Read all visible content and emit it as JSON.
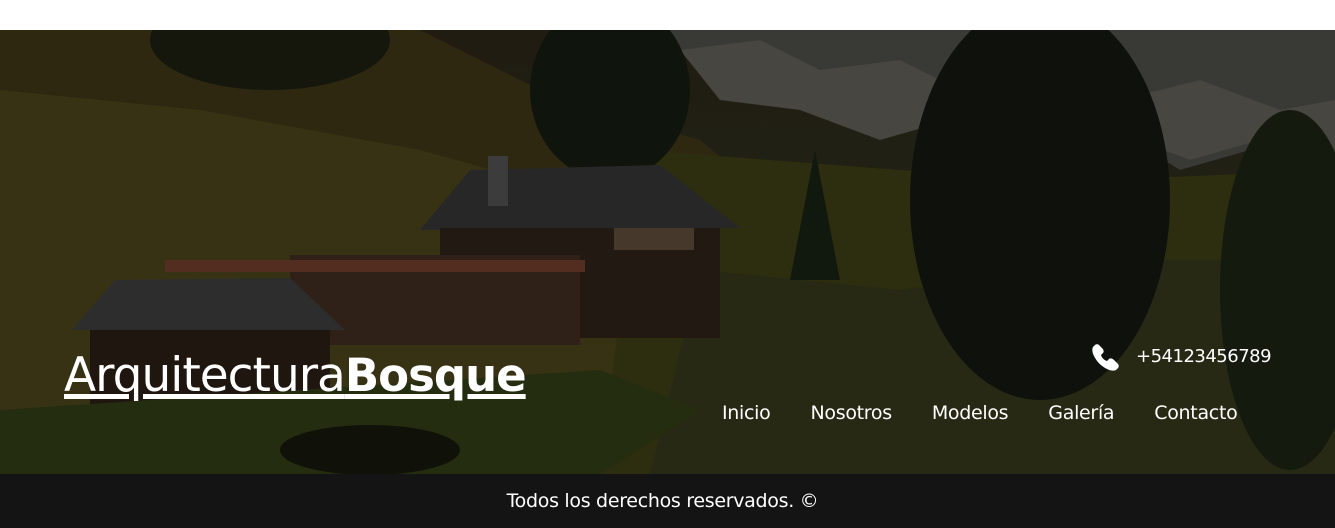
{
  "brand": {
    "light": "Arquitectura",
    "bold": "Bosque"
  },
  "contact": {
    "phone": "+54123456789",
    "icon": "phone-icon"
  },
  "nav": {
    "items": [
      {
        "label": "Inicio"
      },
      {
        "label": "Nosotros"
      },
      {
        "label": "Modelos"
      },
      {
        "label": "Galería"
      },
      {
        "label": "Contacto"
      }
    ]
  },
  "footer": {
    "text": "Todos los derechos reservados. ©"
  },
  "colors": {
    "footer_bg": "#141414",
    "text": "#ffffff"
  }
}
